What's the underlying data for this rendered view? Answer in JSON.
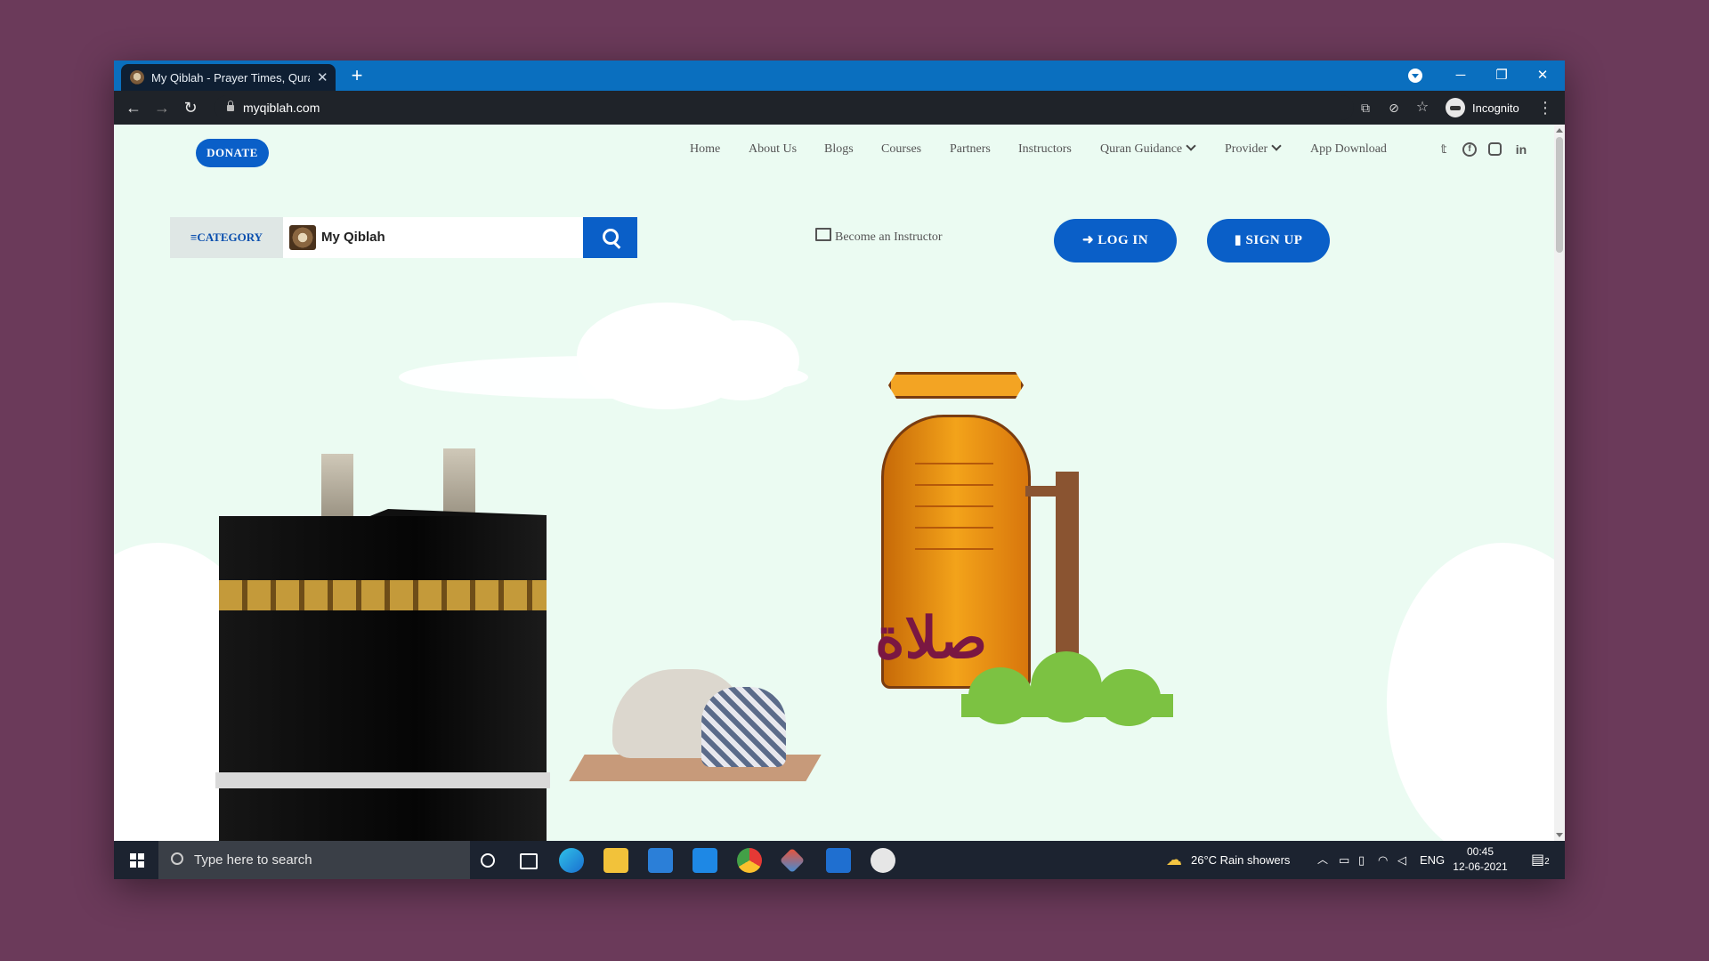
{
  "browser": {
    "tab_title": "My Qiblah - Prayer Times, Quran",
    "tab_close": "✕",
    "new_tab": "+",
    "url": "myqiblah.com",
    "profile_label": "Incognito",
    "window_controls": {
      "minimize": "─",
      "restore": "❐",
      "close": "✕"
    },
    "nav_icons": {
      "back": "←",
      "forward": "→",
      "reload": "↻"
    },
    "right_icons": [
      "translate-icon",
      "eye-off-icon",
      "star-icon",
      "menu-dots-icon"
    ]
  },
  "site": {
    "donate_label": "DONATE",
    "nav": [
      {
        "label": "Home"
      },
      {
        "label": "About Us"
      },
      {
        "label": "Blogs"
      },
      {
        "label": "Courses"
      },
      {
        "label": "Partners"
      },
      {
        "label": "Instructors"
      },
      {
        "label": "Quran Guidance"
      },
      {
        "label": "Provider"
      },
      {
        "label": "App Download"
      }
    ],
    "social": [
      "twitter-icon",
      "facebook-icon",
      "instagram-icon",
      "linkedin-icon"
    ],
    "category_label": "CATEGORY",
    "search_value": "My Qiblah",
    "become_instructor": "Become an Instructor",
    "login_label": "LOG IN",
    "signup_label": "SIGN UP",
    "hero_calligraphy": "صلاة"
  },
  "taskbar": {
    "search_placeholder": "Type here to search",
    "weather": "26°C  Rain showers",
    "language": "ENG",
    "time": "00:45",
    "date": "12-06-2021",
    "notification_count": "2"
  },
  "colors": {
    "brand_blue": "#0a5fc8",
    "page_bg": "#ebfbf2",
    "titlebar": "#0a6fbf"
  }
}
